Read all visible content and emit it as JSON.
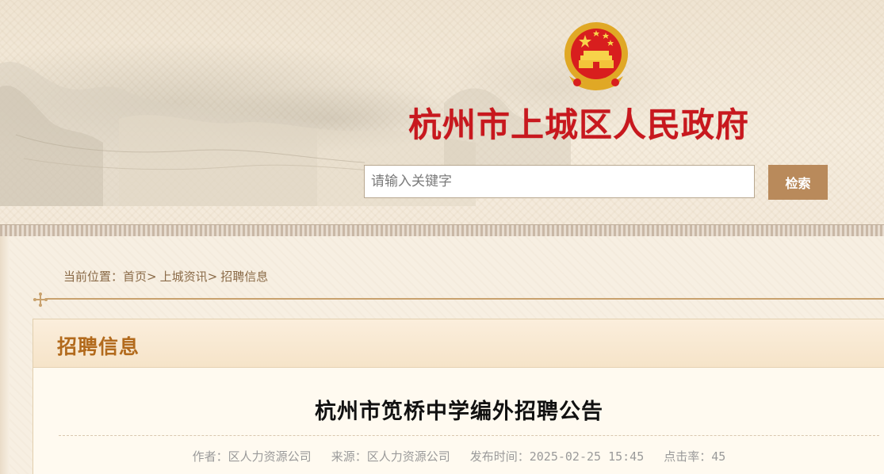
{
  "header": {
    "site_title": "杭州市上城区人民政府",
    "emblem_icon": "national-emblem-icon"
  },
  "search": {
    "placeholder": "请输入关键字",
    "value": "",
    "button_label": "检索"
  },
  "breadcrumb": {
    "label": "当前位置：",
    "items": [
      "首页",
      "上城资讯",
      "招聘信息"
    ],
    "separator": ">"
  },
  "section": {
    "title": "招聘信息"
  },
  "article": {
    "title": "杭州市笕桥中学编外招聘公告",
    "author": "作者：区人力资源公司",
    "source": "来源：区人力资源公司",
    "published": "发布时间：2025-02-25 15:45",
    "clicks": "点击率：45"
  },
  "colors": {
    "title_red": "#c8181e",
    "accent_brown": "#b98a5b",
    "section_title": "#b26a1c",
    "divider": "#c9a26e"
  }
}
